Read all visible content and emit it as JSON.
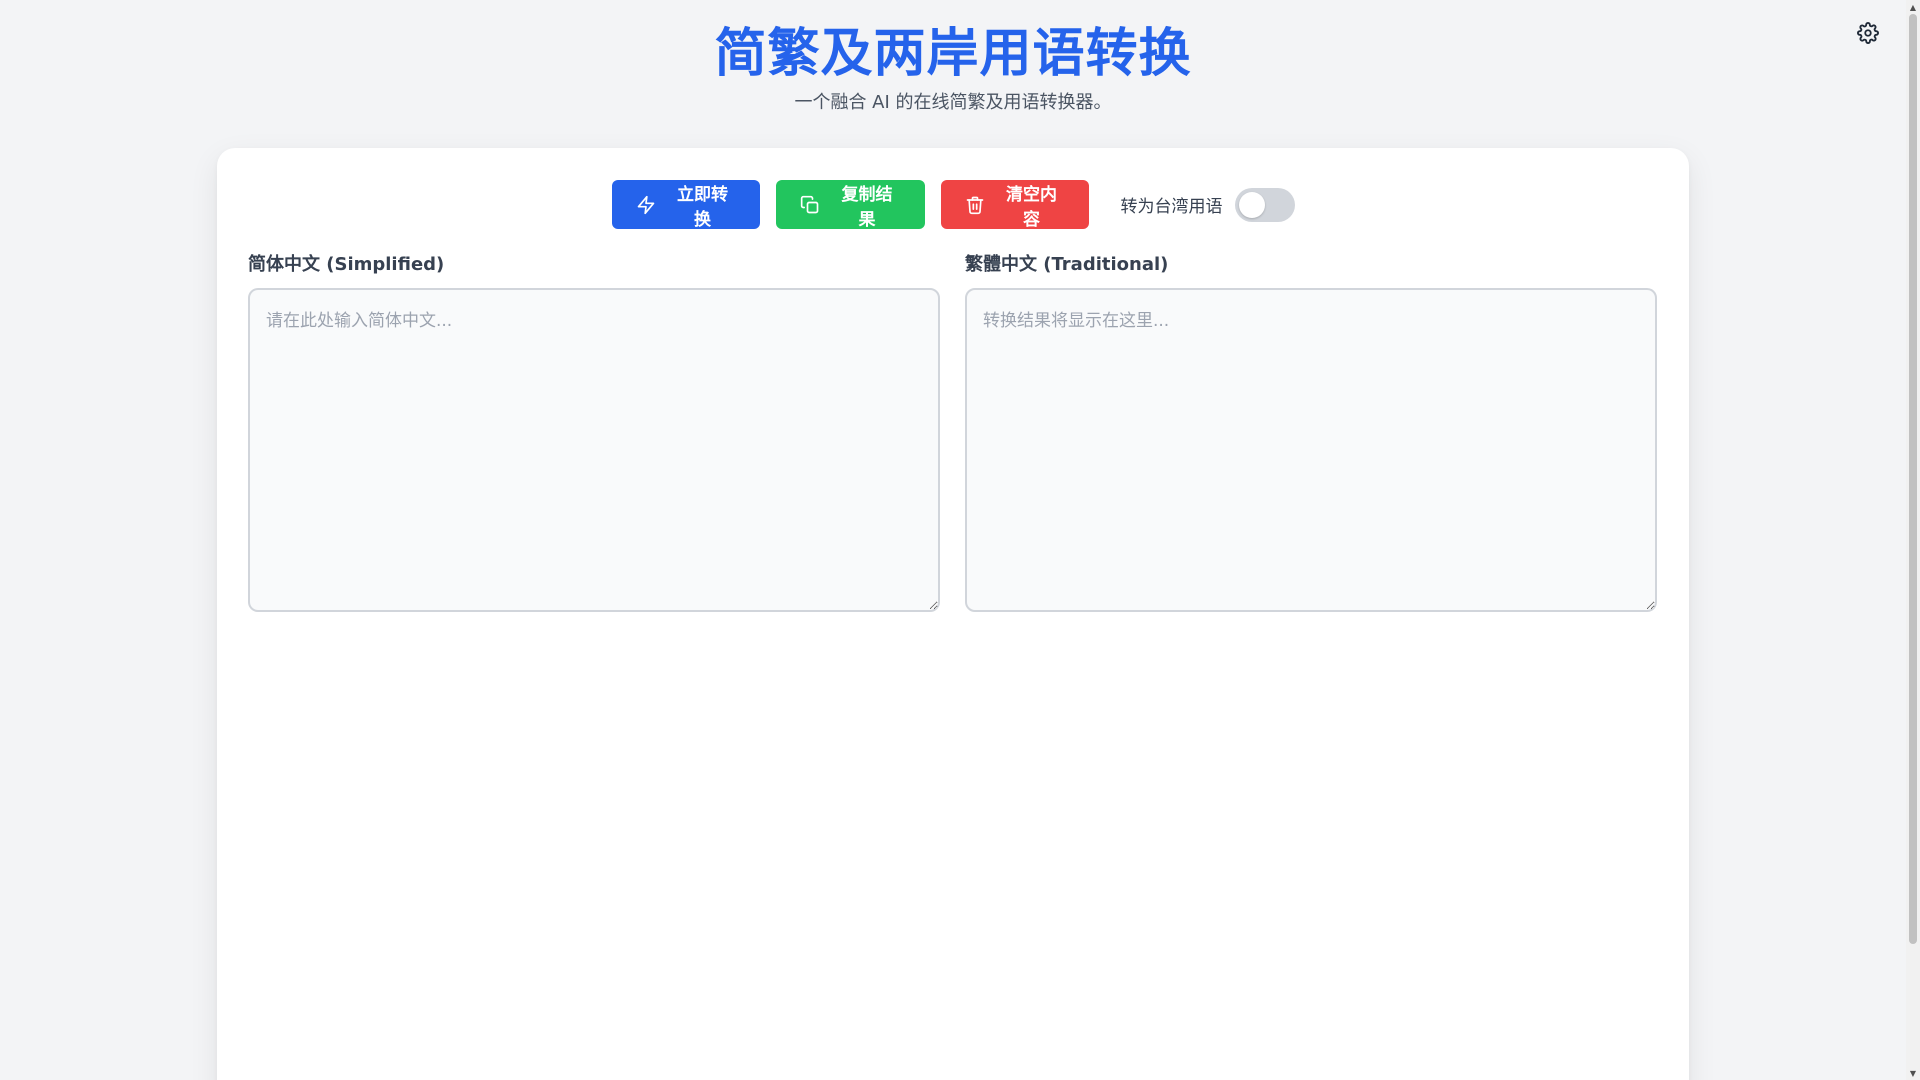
{
  "header": {
    "title": "简繁及两岸用语转换",
    "subtitle": "一个融合 AI 的在线简繁及用语转换器。"
  },
  "settings": {
    "icon": "gear-icon"
  },
  "toolbar": {
    "convert_label": "立即转换",
    "copy_label": "复制结果",
    "clear_label": "清空内容",
    "toggle_label": "转为台湾用语",
    "toggle_on": false,
    "convert_color": "#2563eb",
    "copy_color": "#22c55e",
    "clear_color": "#ef4444"
  },
  "input_panel": {
    "label": "简体中文 (Simplified)",
    "placeholder": "请在此处输入简体中文...",
    "value": ""
  },
  "output_panel": {
    "label": "繁體中文 (Traditional)",
    "placeholder": "转换结果将显示在这里...",
    "value": ""
  },
  "colors": {
    "accent": "#2563eb",
    "background": "#f3f4f6"
  }
}
